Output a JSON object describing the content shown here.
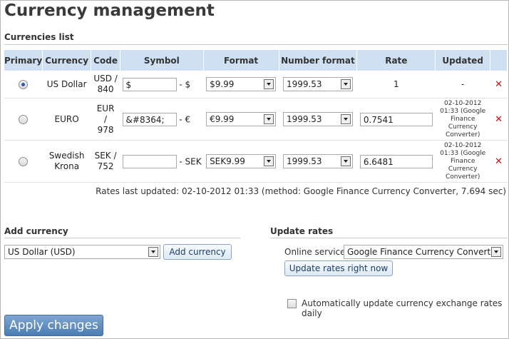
{
  "page": {
    "title": "Currency management"
  },
  "currencies_list": {
    "section_title": "Currencies list",
    "columns": [
      "Primary",
      "Currency",
      "Code",
      "Symbol",
      "Format",
      "Number format",
      "Rate",
      "Updated"
    ],
    "rows": [
      {
        "primary": true,
        "currency": "US Dollar",
        "code": "USD / 840",
        "symbol_value": "$",
        "symbol_suffix": "- $",
        "format": "$9.99",
        "number_format": "1999.53",
        "rate": "1",
        "rate_editable": false,
        "updated": "-"
      },
      {
        "primary": false,
        "currency": "EURO",
        "code": "EUR / 978",
        "symbol_value": "&#8364;",
        "symbol_suffix": "- €",
        "format": "€9.99",
        "number_format": "1999.53",
        "rate": "0.7541",
        "rate_editable": true,
        "updated": "02-10-2012 01:33 (Google Finance Currency Converter)"
      },
      {
        "primary": false,
        "currency": "Swedish Krona",
        "code": "SEK / 752",
        "symbol_value": "",
        "symbol_suffix": "- SEK",
        "format": "SEK9.99",
        "number_format": "1999.53",
        "rate": "6.6481",
        "rate_editable": true,
        "updated": "02-10-2012 01:33 (Google Finance Currency Converter)"
      }
    ],
    "rates_last_updated": "Rates last updated: 02-10-2012 01:33 (method: Google Finance Currency Converter, 7.694 sec)"
  },
  "add_currency": {
    "section_title": "Add currency",
    "select_value": "US Dollar (USD)",
    "button_label": "Add currency"
  },
  "update_rates": {
    "section_title": "Update rates",
    "service_label": "Online service:",
    "service_value": "Google Finance Currency Converter",
    "button_label": "Update rates right now",
    "auto_update_label": "Automatically update currency exchange rates daily",
    "auto_update_checked": false
  },
  "apply_button": "Apply changes",
  "colors": {
    "header_bg": "#cfe0f3",
    "delete_icon": "#d10f0f",
    "apply_button": "#5a88bb"
  }
}
